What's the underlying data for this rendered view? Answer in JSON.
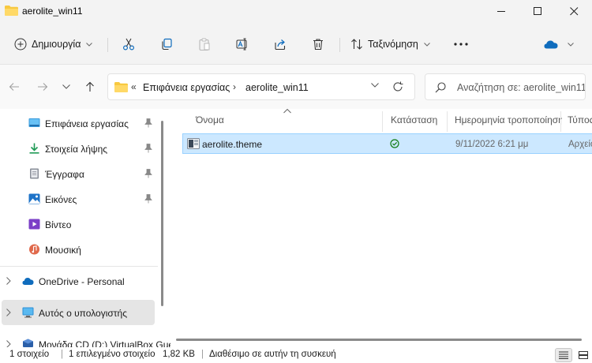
{
  "window": {
    "title": "aerolite_win11"
  },
  "command_bar": {
    "new_label": "Δημιουργία",
    "sort_label": "Ταξινόμηση",
    "cloud_color": "#0f6cbd"
  },
  "address": {
    "overflow": "«",
    "crumbs": [
      "Επιφάνεια εργασίας",
      "aerolite_win11"
    ],
    "separator": "›"
  },
  "search": {
    "placeholder": "Αναζήτηση σε: aerolite_win11"
  },
  "nav": {
    "quick_access": [
      {
        "label": "Επιφάνεια εργασίας",
        "icon": "desktop-icon",
        "pinned": true
      },
      {
        "label": "Στοιχεία λήψης",
        "icon": "download-icon",
        "pinned": true
      },
      {
        "label": "Έγγραφα",
        "icon": "documents-icon",
        "pinned": true
      },
      {
        "label": "Εικόνες",
        "icon": "pictures-icon",
        "pinned": true
      },
      {
        "label": "Βίντεο",
        "icon": "videos-icon",
        "pinned": false
      },
      {
        "label": "Μουσική",
        "icon": "music-icon",
        "pinned": false
      }
    ],
    "tree": [
      {
        "label": "OneDrive - Personal",
        "icon": "onedrive-icon",
        "selected": false
      },
      {
        "label": "Αυτός ο υπολογιστής",
        "icon": "this-pc-icon",
        "selected": true
      },
      {
        "label": "Μονάδα CD (D:) VirtualBox Guest Additions",
        "icon": "cd-drive-icon",
        "selected": false
      }
    ]
  },
  "columns": [
    "Όνομα",
    "Κατάσταση",
    "Ημερομηνία τροποποίησης",
    "Τύπος"
  ],
  "files": [
    {
      "name": "aerolite.theme",
      "status": "synced-check-icon",
      "modified": "9/11/2022 6:21 μμ",
      "type": "Αρχείο θέματος",
      "selected": true
    }
  ],
  "status": {
    "count": "1 στοιχείο",
    "selected": "1 επιλεγμένο στοιχείο",
    "size": "1,82 KB",
    "availability": "Διαθέσιμο σε αυτήν τη συσκευή"
  },
  "colors": {
    "selection_bg": "#cce8ff",
    "selection_border": "#99d1ff",
    "status_green": "#0f7b0f",
    "folder_yellow": "#f8c940"
  }
}
